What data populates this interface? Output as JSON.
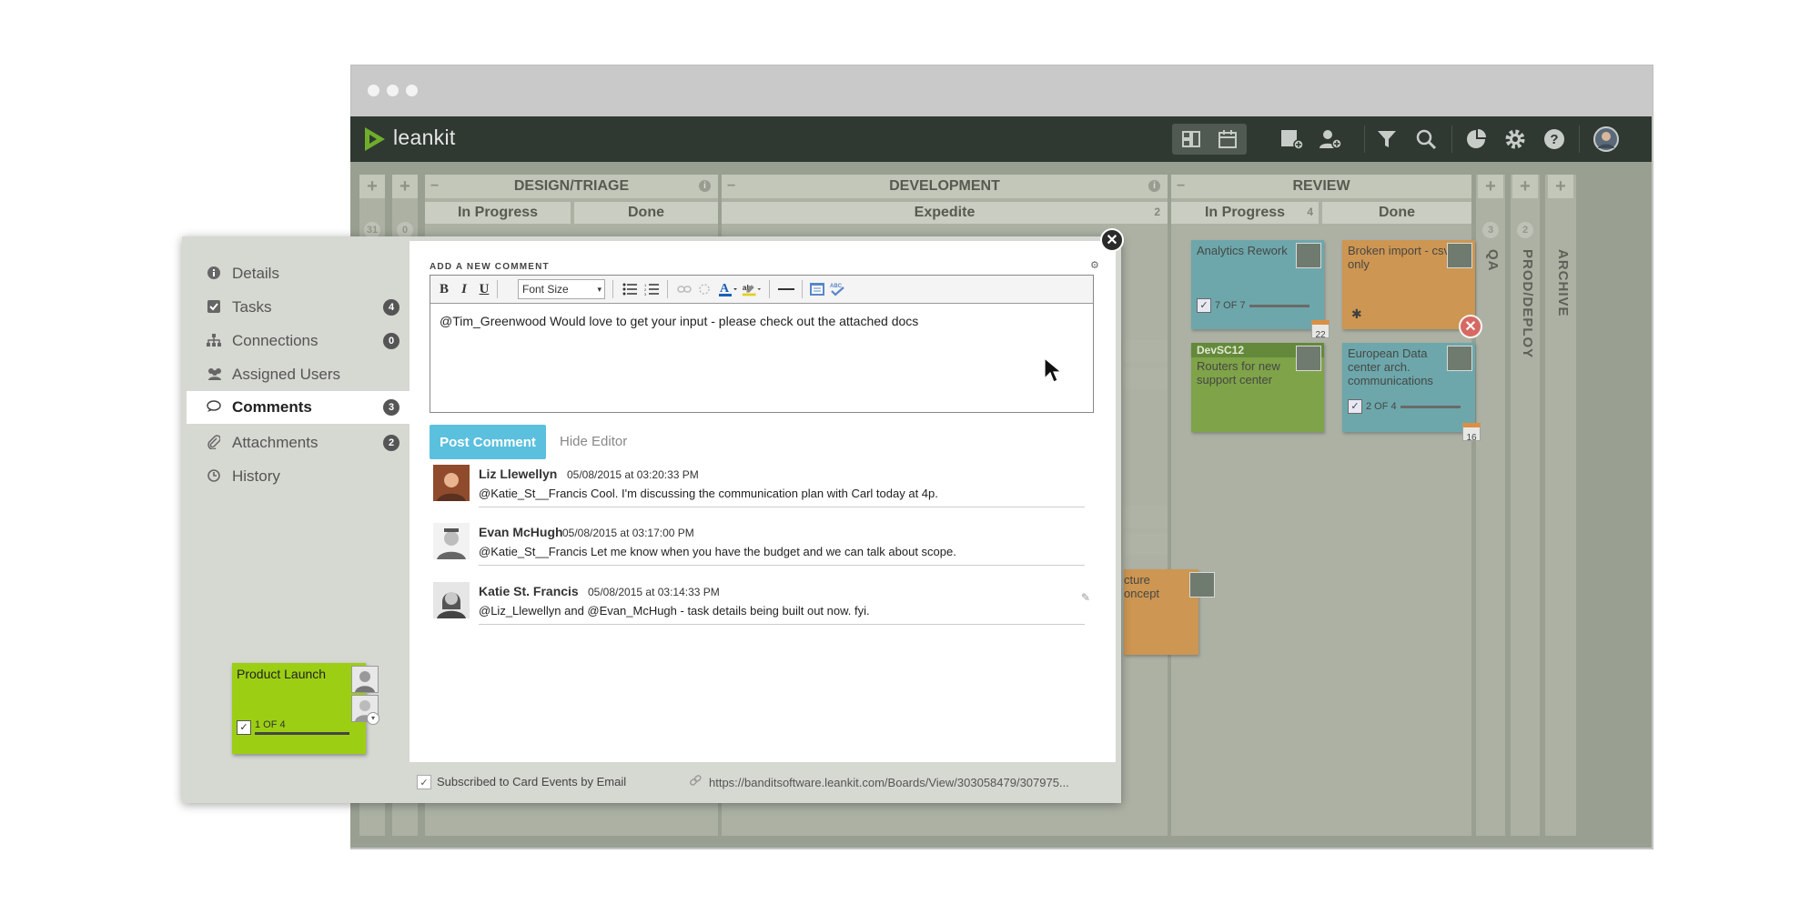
{
  "app": {
    "name": "leankit"
  },
  "colors": {
    "accent": "#5bc0de",
    "appbar": "#2f3831",
    "board": "#8f9587"
  },
  "toolbar": {
    "icons": [
      "board-view-icon",
      "calendar-view-icon",
      "add-card-icon",
      "add-user-icon",
      "filter-icon",
      "search-icon",
      "chart-icon",
      "gear-icon",
      "help-icon",
      "user-avatar-icon"
    ]
  },
  "board": {
    "lanes": {
      "design_triage": {
        "title": "DESIGN/TRIAGE",
        "sub": [
          "In Progress",
          "Done"
        ]
      },
      "development": {
        "title": "DEVELOPMENT",
        "sub": [
          "Expedite"
        ],
        "expedite_count": "2"
      },
      "review": {
        "title": "REVIEW",
        "sub": [
          "In Progress",
          "Done"
        ],
        "in_progress_count": "4"
      },
      "qa": {
        "title": "QA",
        "count": "3"
      },
      "prod_deploy": {
        "title": "PROD/DEPLOY",
        "count": "2"
      },
      "archive": {
        "title": "ARCHIVE"
      },
      "backlog_counts": [
        "31",
        "0"
      ]
    },
    "cards": {
      "analytics": {
        "title": "Analytics Rework",
        "progress": "7 OF 7",
        "due": "22"
      },
      "broken_import": {
        "title": "Broken import - csv only"
      },
      "devsc12": {
        "tag": "DevSC12",
        "title": "Routers for new support center"
      },
      "european": {
        "title": "European Data center arch. communications",
        "progress": "2 OF 4",
        "due": "16"
      },
      "partial": {
        "title": "cture oncept"
      }
    }
  },
  "dialog": {
    "sidebar": {
      "items": [
        {
          "label": "Details",
          "icon": "info-icon"
        },
        {
          "label": "Tasks",
          "icon": "checkbox-icon",
          "badge": "4"
        },
        {
          "label": "Connections",
          "icon": "sitemap-icon",
          "badge": "0"
        },
        {
          "label": "Assigned Users",
          "icon": "users-icon"
        },
        {
          "label": "Comments",
          "icon": "comment-icon",
          "badge": "3"
        },
        {
          "label": "Attachments",
          "icon": "paperclip-icon",
          "badge": "2"
        },
        {
          "label": "History",
          "icon": "clock-icon"
        }
      ]
    },
    "editor": {
      "label": "ADD A NEW COMMENT",
      "font_size": "Font Size",
      "text": "@Tim_Greenwood Would love to get your input - please check out the attached docs"
    },
    "post_label": "Post Comment",
    "hide_label": "Hide Editor",
    "comments": [
      {
        "name": "Liz Llewellyn",
        "date": "05/08/2015 at 03:20:33 PM",
        "text": "@Katie_St__Francis Cool. I'm discussing the communication plan with Carl today at 4p."
      },
      {
        "name": "Evan McHugh",
        "date": "05/08/2015 at 03:17:00 PM",
        "text": "@Katie_St__Francis Let me know when you have the budget and we can talk about scope."
      },
      {
        "name": "Katie St. Francis",
        "date": "05/08/2015 at 03:14:33 PM",
        "text": "@Liz_Llewellyn and @Evan_McHugh - task details being built out now. fyi."
      }
    ],
    "footer": {
      "subscribed": "Subscribed to Card Events by Email",
      "url": "https://banditsoftware.leankit.com/Boards/View/303058479/307975..."
    },
    "card": {
      "title": "Product Launch",
      "progress": "1 OF 4"
    }
  }
}
